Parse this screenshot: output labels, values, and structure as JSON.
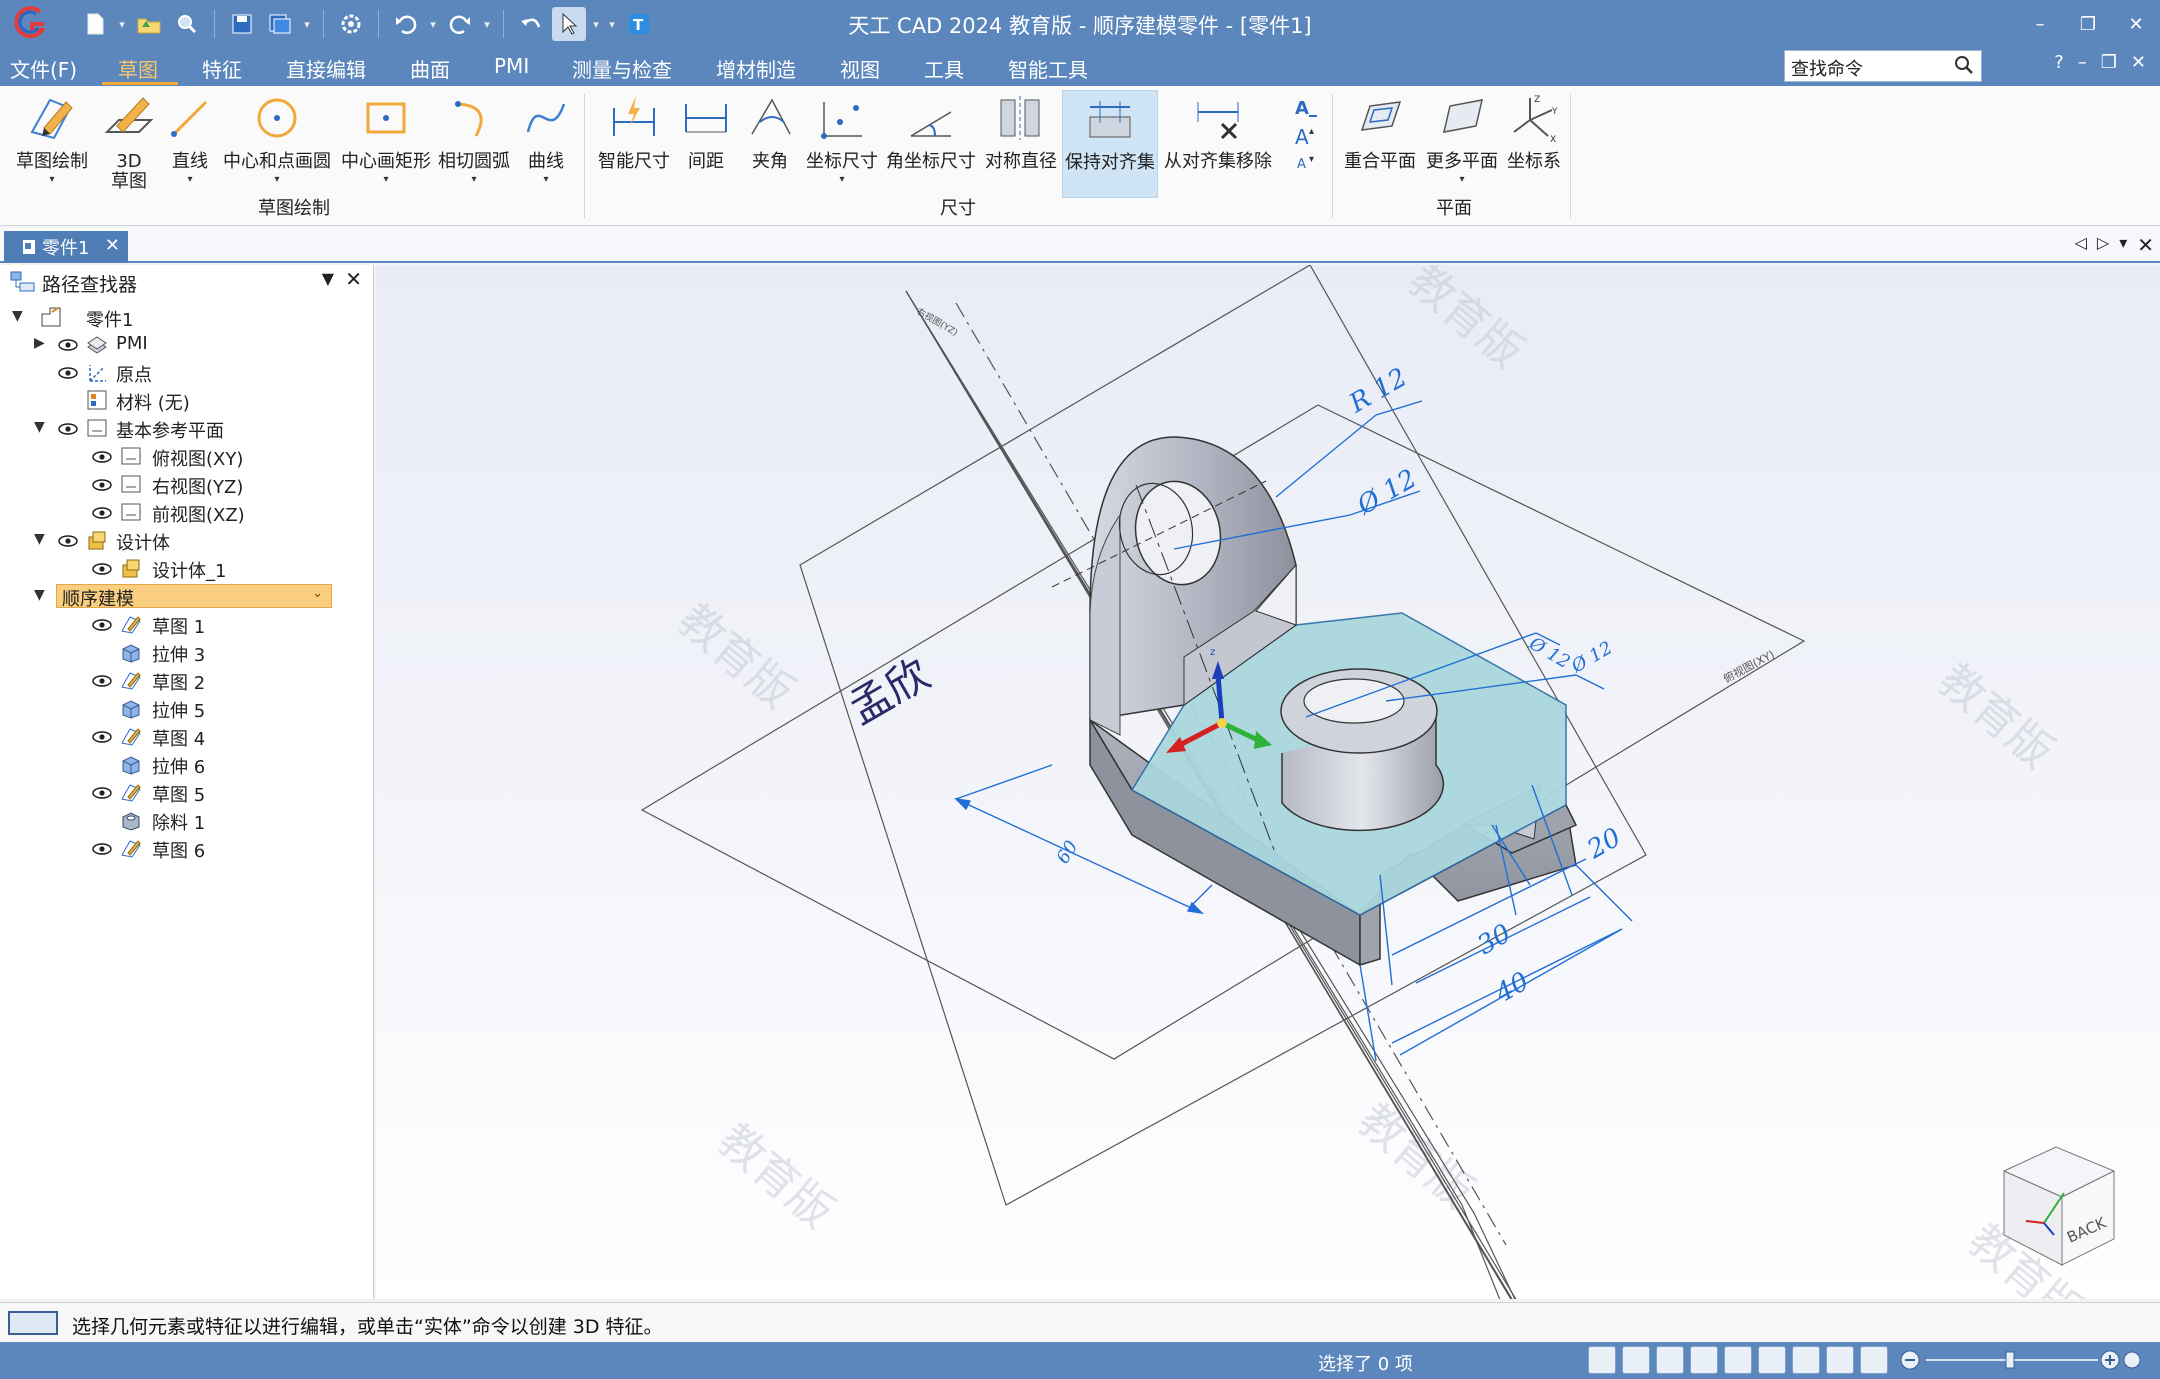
{
  "window": {
    "title": "天工 CAD 2024 教育版 - 顺序建模零件 - [零件1]"
  },
  "menubar": {
    "items": [
      "文件(F)",
      "草图",
      "特征",
      "直接编辑",
      "曲面",
      "PMI",
      "测量与检查",
      "增材制造",
      "视图",
      "工具",
      "智能工具"
    ],
    "active": "草图",
    "search_placeholder": "查找命令"
  },
  "ribbon": {
    "sketch_draw": {
      "group_label": "草图绘制",
      "buttons": [
        "草图绘制",
        "3D\n草图",
        "直线",
        "中心和点画圆",
        "中心画矩形",
        "相切圆弧",
        "曲线"
      ]
    },
    "dimension": {
      "group_label": "尺寸",
      "buttons": [
        "智能尺寸",
        "间距",
        "夹角",
        "坐标尺寸",
        "角坐标尺寸",
        "对称直径",
        "保持对齐集",
        "从对齐集移除"
      ],
      "highlighted": "保持对齐集"
    },
    "plane": {
      "group_label": "平面",
      "buttons": [
        "重合平面",
        "更多平面",
        "坐标系"
      ]
    }
  },
  "doc_tab": {
    "label": "零件1"
  },
  "pathfinder": {
    "title": "路径查找器",
    "items": [
      {
        "label": "零件1"
      },
      {
        "label": "PMI"
      },
      {
        "label": "原点"
      },
      {
        "label": "材料 (无)"
      },
      {
        "label": "基本参考平面"
      },
      {
        "label": "俯视图(XY)"
      },
      {
        "label": "右视图(YZ)"
      },
      {
        "label": "前视图(XZ)"
      },
      {
        "label": "设计体"
      },
      {
        "label": "设计体_1"
      },
      {
        "label": "顺序建模"
      },
      {
        "label": "草图 1"
      },
      {
        "label": "拉伸 3"
      },
      {
        "label": "草图 2"
      },
      {
        "label": "拉伸 5"
      },
      {
        "label": "草图 4"
      },
      {
        "label": "拉伸 6"
      },
      {
        "label": "草图 5"
      },
      {
        "label": "除料 1"
      },
      {
        "label": "草图 6"
      }
    ]
  },
  "canvas": {
    "handwritten": "孟欣",
    "watermark": "教育版",
    "plane_label_right": "俯视图(XY)",
    "plane_label_top": "右视图(YZ)",
    "dims": {
      "r12": "R 12",
      "d12a": "Ø 12",
      "d12b": "Ø 12",
      "d12c": "Ø 12",
      "d60": "60",
      "d20": "20",
      "d30": "30",
      "d40": "40"
    },
    "viewcube_label": "BACK"
  },
  "status": {
    "prompt": "选择几何元素或特征以进行编辑，或单击“实体”命令以创建 3D 特征。",
    "selection": "选择了 0 项"
  },
  "colors": {
    "chrome_blue": "#5b87bd",
    "accent_orange": "#f2a93b",
    "dim_blue": "#1f6fd6",
    "highlight_face": "#a9d6dd"
  }
}
